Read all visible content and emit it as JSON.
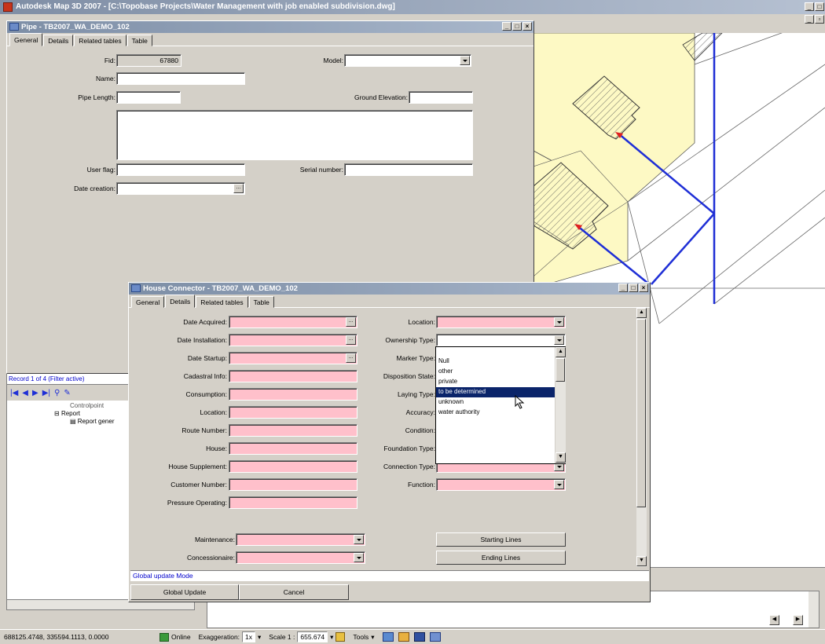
{
  "app": {
    "title": "Autodesk Map 3D 2007 - [C:\\Topobase Projects\\Water Management with job enabled subdivision.dwg]"
  },
  "pipe_form": {
    "title": "Pipe - TB2007_WA_DEMO_102",
    "tabs": [
      "General",
      "Details",
      "Related tables",
      "Table"
    ],
    "fid_label": "Fid:",
    "fid_value": "67880",
    "model_label": "Model:",
    "model_value": "",
    "name_label": "Name:",
    "name_value": "",
    "pipe_length_label": "Pipe Length:",
    "pipe_length_value": "",
    "ground_elevation_label": "Ground Elevation:",
    "ground_elevation_value": "",
    "user_flag_label": "User flag:",
    "user_flag_value": "",
    "serial_number_label": "Serial number:",
    "serial_number_value": "",
    "date_creation_label": "Date creation:",
    "date_creation_value": ""
  },
  "explorer": {
    "record_text": "Record 1 of 4 (Filter active)",
    "tree": [
      "Controlpoint",
      "Report",
      "Report gener"
    ]
  },
  "house_connector": {
    "title": "House Connector - TB2007_WA_DEMO_102",
    "tabs": [
      "General",
      "Details",
      "Related tables",
      "Table"
    ],
    "left_labels": [
      "Date Acquired:",
      "Date Installation:",
      "Date Startup:",
      "Cadastral Info:",
      "Consumption:",
      "Location:",
      "Route Number:",
      "House:",
      "House Supplement:",
      "Customer Number:",
      "Pressure Operating:"
    ],
    "right_labels": [
      "Location:",
      "Ownership Type:",
      "Marker Type:",
      "Disposition State:",
      "Laying Type:",
      "Accuracy:",
      "Condition:",
      "Foundation Type:",
      "Connection Type:",
      "Function:"
    ],
    "maintenance_label": "Maintenance:",
    "concessionaire_label": "Concessionaire:",
    "starting_lines_label": "Starting Lines",
    "ending_lines_label": "Ending Lines",
    "mode_text": "Global update Mode",
    "global_update_label": "Global Update",
    "cancel_label": "Cancel",
    "ownership_options": [
      "Null",
      "other",
      "private",
      "to be determined",
      "unknown",
      "water authority"
    ],
    "ownership_selected": "to be determined"
  },
  "statusbar": {
    "coords": "688125.4748, 335594.1113, 0.0000",
    "online": "Online",
    "exaggeration_label": "Exaggeration:",
    "exaggeration_value": "1x",
    "scale_label": "Scale 1 :",
    "scale_value": "655.674",
    "tools_label": "Tools"
  },
  "colors": {
    "required_field": "#ffc0cb",
    "selection": "#0a246a",
    "pipe_line": "#1f2fd6",
    "parcel": "#fdf9c4"
  }
}
